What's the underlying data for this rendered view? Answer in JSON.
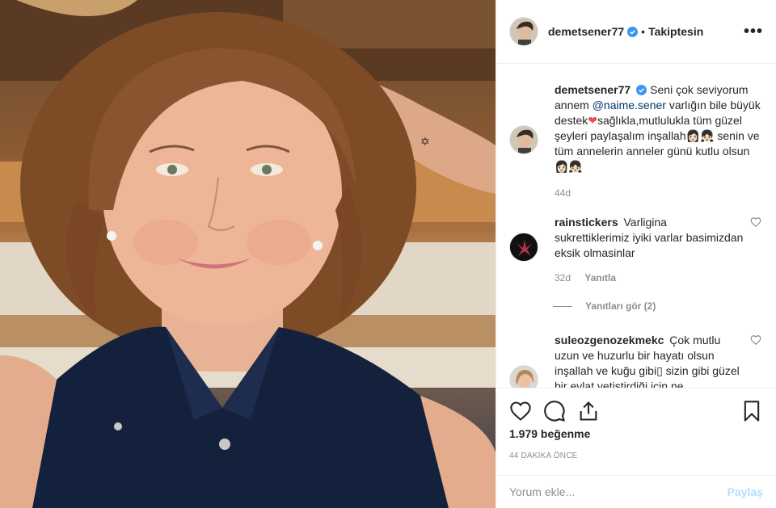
{
  "post": {
    "username": "demetsener77",
    "separator": "•",
    "follow_status": "Takiptesin",
    "more": "•••"
  },
  "caption": {
    "username": "demetsener77",
    "text_1": "Seni çok seviyorum annem",
    "mention": "@naime.sener",
    "text_2": "varlığın bile büyük destek",
    "heart": "❤",
    "text_3": "sağlıkla,mutlulukla tüm güzel şeyleri paylaşalım inşallah👩🏻‍👧🏻 senin ve tüm annelerin anneler günü kutlu olsun👩🏻‍👧🏻",
    "time": "44d"
  },
  "comments": [
    {
      "username": "rainstickers",
      "text": "Varligina sukrettiklerimiz iyiki varlar basimizdan eksik olmasinlar",
      "time": "32d",
      "reply": "Yanıtla",
      "view_replies": "Yanıtları gör (2)"
    },
    {
      "username": "suleozgenozekmekc",
      "text": "Çok mutlu uzun ve huzurlu bir hayatı olsun inşallah ve kuğu gibi▯ sizin gibi güzel bir evlat yetiştirdiği için ne"
    }
  ],
  "likes": "1.979 beğenme",
  "posted_ago": "44 DAKİKA ÖNCE",
  "add_comment": {
    "placeholder": "Yorum ekle...",
    "post_label": "Paylaş"
  },
  "colors": {
    "verified": "#3897f0",
    "mention": "#00376b",
    "heart": "#ed4956",
    "post_disabled": "#b2dffc"
  },
  "icons": [
    "verified-icon",
    "more-icon",
    "heart-icon",
    "comment-icon",
    "share-icon",
    "bookmark-icon"
  ]
}
